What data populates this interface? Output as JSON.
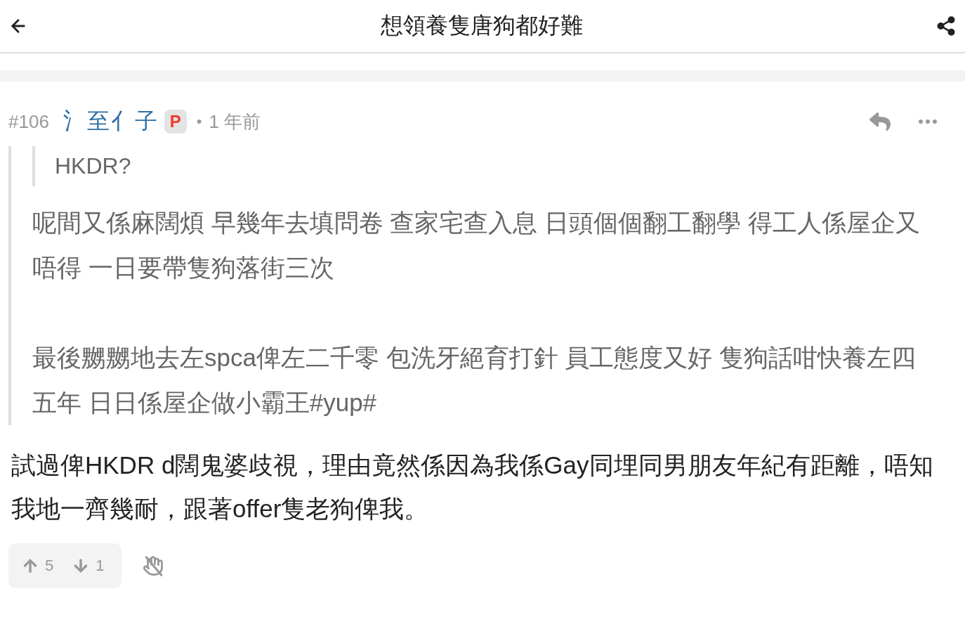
{
  "header": {
    "title": "想領養隻唐狗都好難"
  },
  "post": {
    "number": "#106",
    "author": "氵至亻子",
    "badge": "P",
    "separator": "•",
    "time": "1 年前",
    "quote": {
      "nested_quote": "HKDR?",
      "paragraphs": [
        "呢間又係麻闊煩 早幾年去填問卷 查家宅查入息 日頭個個翻工翻學 得工人係屋企又唔得 一日要帶隻狗落街三次",
        "最後嬲嬲地去左spca俾左二千零 包洗牙絕育打針 員工態度又好 隻狗話咁快養左四五年 日日係屋企做小霸王#yup#"
      ]
    },
    "body": "試過俾HKDR d闊鬼婆歧視，理由竟然係因為我係Gay同埋同男朋友年紀有距離，唔知我地一齊幾耐，跟著offer隻老狗俾我。",
    "upvotes": "5",
    "downvotes": "1"
  }
}
